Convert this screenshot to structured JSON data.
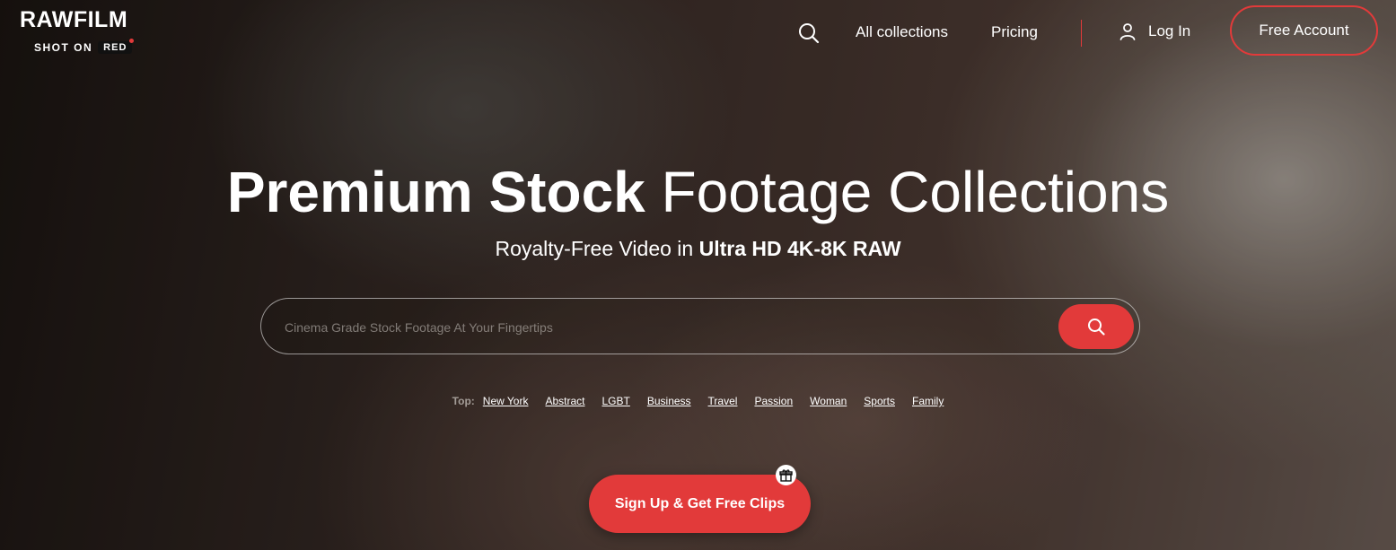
{
  "brand": {
    "name": "RAWFILM",
    "tagline": "SHOT ON",
    "badge": "RED"
  },
  "nav": {
    "search_icon": "search-icon",
    "links": [
      "All collections",
      "Pricing"
    ],
    "login_label": "Log In",
    "login_icon": "user-icon",
    "free_account_label": "Free Account"
  },
  "hero": {
    "title_bold": "Premium Stock",
    "title_light": "Footage Collections",
    "subtitle_prefix": "Royalty-Free Video in",
    "subtitle_bold": "Ultra HD 4K-8K RAW"
  },
  "search": {
    "placeholder": "Cinema Grade Stock Footage At Your Fingertips",
    "value": "",
    "button_icon": "search-icon"
  },
  "top_tags": {
    "label": "Top:",
    "items": [
      "New York",
      "Abstract",
      "LGBT",
      "Business",
      "Travel",
      "Passion",
      "Woman",
      "Sports",
      "Family"
    ]
  },
  "cta": {
    "label": "Sign Up & Get Free Clips",
    "badge_icon": "gift-icon"
  },
  "colors": {
    "accent": "#e23a3a",
    "text": "#ffffff"
  }
}
